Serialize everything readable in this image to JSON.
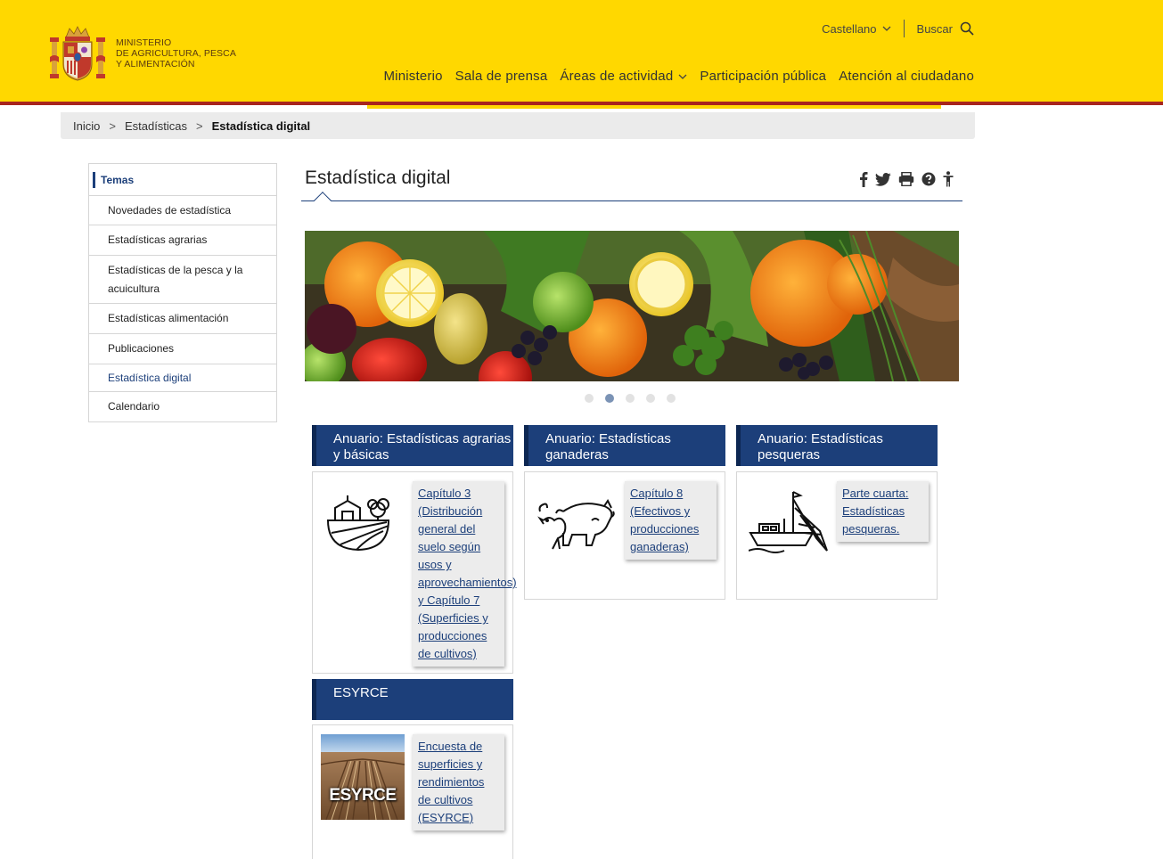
{
  "header": {
    "logo_lines": [
      "MINISTERIO",
      "DE AGRICULTURA, PESCA",
      "Y ALIMENTACIÓN"
    ],
    "lang_label": "Castellano",
    "search_label": "Buscar",
    "nav": [
      {
        "label": "Ministerio"
      },
      {
        "label": "Sala de prensa"
      },
      {
        "label": "Áreas de actividad"
      },
      {
        "label": "Participación pública"
      },
      {
        "label": "Atención al ciudadano"
      }
    ]
  },
  "breadcrumb": {
    "items": [
      "Inicio",
      "Estadísticas"
    ],
    "current": "Estadística digital",
    "separator": ">"
  },
  "sidebar": {
    "title": "Temas",
    "items": [
      {
        "label": "Novedades de estadística"
      },
      {
        "label": "Estadísticas agrarias"
      },
      {
        "label": "Estadísticas de la pesca y la acuicultura"
      },
      {
        "label": "Estadísticas alimentación"
      },
      {
        "label": "Publicaciones"
      },
      {
        "label": "Estadística digital"
      },
      {
        "label": "Calendario"
      }
    ]
  },
  "content": {
    "title": "Estadística digital",
    "slider_dots": 5,
    "slider_active": 1
  },
  "cards": [
    {
      "title": "Anuario: Estadísticas agrarias y básicas",
      "link": "Capítulo 3 (Distribución general del suelo según usos y aprovechamientos) y Capítulo 7 (Superficies y producciones de cultivos)",
      "icon": "farm-field-icon"
    },
    {
      "title": "Anuario: Estadísticas ganaderas",
      "link": "Capítulo 8 (Efectivos y producciones ganaderas)",
      "icon": "livestock-icon"
    },
    {
      "title": "Anuario: Estadísticas pesqueras",
      "link": "Parte cuarta: Estadísticas pesqueras.",
      "icon": "fishing-boat-icon"
    },
    {
      "title": "ESYRCE",
      "link": "Encuesta de superficies y rendimientos de cultivos (ESYRCE)",
      "icon": "esyrce-image",
      "image_label": "ESYRCE"
    }
  ],
  "colors": {
    "header_yellow": "#ffd800",
    "header_red": "#a7251e",
    "brand_blue": "#1c3f7a"
  }
}
